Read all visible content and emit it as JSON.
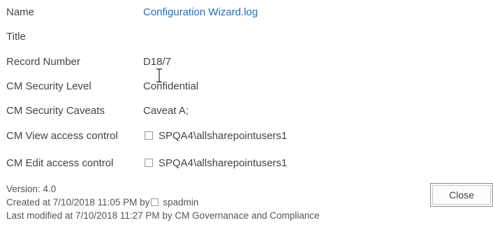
{
  "fields": [
    {
      "label": "Name",
      "value": "Configuration Wizard.log",
      "is_link": true
    },
    {
      "label": "Title",
      "value": ""
    },
    {
      "label": "Record Number",
      "value": "D18/7"
    },
    {
      "label": "CM Security Level",
      "value": "Confidential"
    },
    {
      "label": "CM Security Caveats",
      "value": "Caveat A;"
    },
    {
      "label": "CM View access control",
      "value": "SPQA4\\allsharepointusers1",
      "has_checkbox": true
    },
    {
      "label": "CM Edit access control",
      "value": "SPQA4\\allsharepointusers1",
      "has_checkbox": true
    }
  ],
  "footer": {
    "version": "Version: 4.0",
    "created_prefix": "Created at 7/10/2018 11:05 PM  by",
    "created_by": "spadmin",
    "modified": "Last modified at 7/10/2018 11:27 PM  by CM Governanace and Compliance"
  },
  "close_label": "Close"
}
